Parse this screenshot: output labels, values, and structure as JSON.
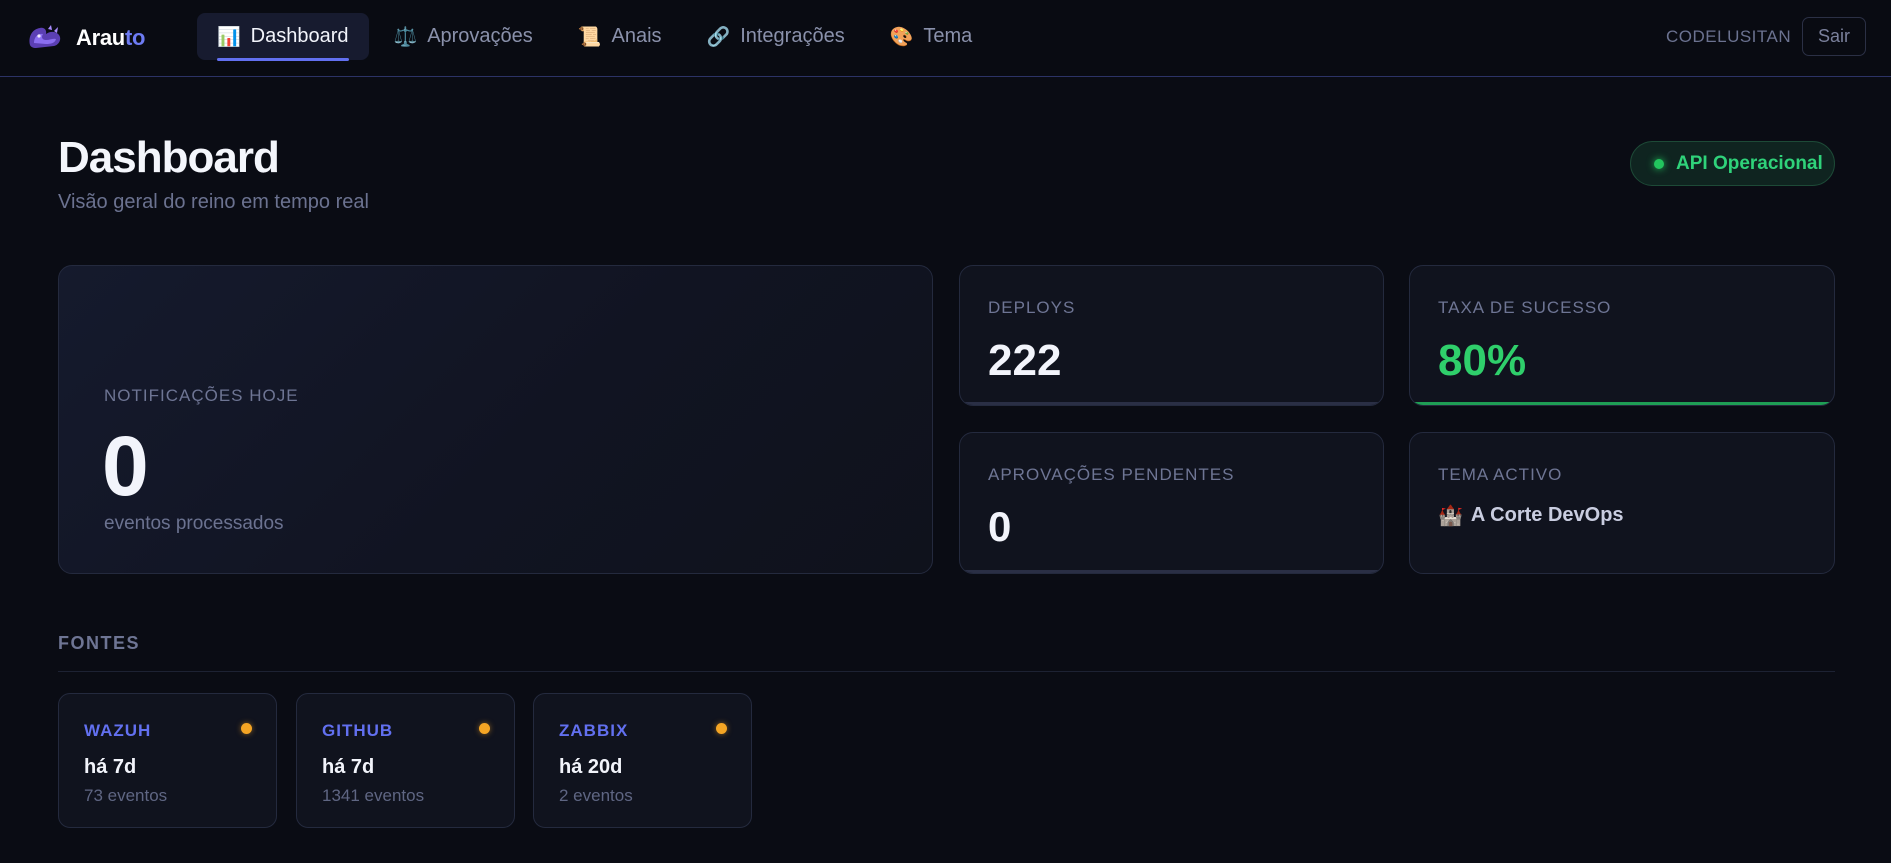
{
  "app": {
    "name_part1": "Arau",
    "name_part2": "to"
  },
  "nav": {
    "tabs": [
      {
        "icon": "📊",
        "label": "Dashboard",
        "active": true
      },
      {
        "icon": "⚖️",
        "label": "Aprovações"
      },
      {
        "icon": "📜",
        "label": "Anais"
      },
      {
        "icon": "🔗",
        "label": "Integrações"
      },
      {
        "icon": "🎨",
        "label": "Tema"
      }
    ],
    "user": "CODELUSITAN",
    "logout_label": "Sair"
  },
  "header": {
    "title": "Dashboard",
    "subtitle": "Visão geral do reino em tempo real",
    "api_status": "API Operacional",
    "api_color": "#22c55e"
  },
  "stats": {
    "notifications": {
      "label": "NOTIFICAÇÕES HOJE",
      "value": "0",
      "sub": "eventos processados"
    },
    "deploys": {
      "label": "DEPLOYS",
      "value": "222"
    },
    "success_rate": {
      "label": "TAXA DE SUCESSO",
      "value": "80%",
      "color": "#2fcf6b"
    },
    "pending": {
      "label": "APROVAÇÕES PENDENTES",
      "value": "0"
    },
    "theme": {
      "label": "TEMA ACTIVO",
      "icon": "🏰",
      "value": "A Corte DevOps"
    }
  },
  "sources": {
    "title": "FONTES",
    "items": [
      {
        "name": "WAZUH",
        "ago": "há 7d",
        "events": "73 eventos",
        "status_color": "#f5a524"
      },
      {
        "name": "GITHUB",
        "ago": "há 7d",
        "events": "1341 eventos",
        "status_color": "#f5a524"
      },
      {
        "name": "ZABBIX",
        "ago": "há 20d",
        "events": "2 eventos",
        "status_color": "#f5a524"
      }
    ]
  }
}
